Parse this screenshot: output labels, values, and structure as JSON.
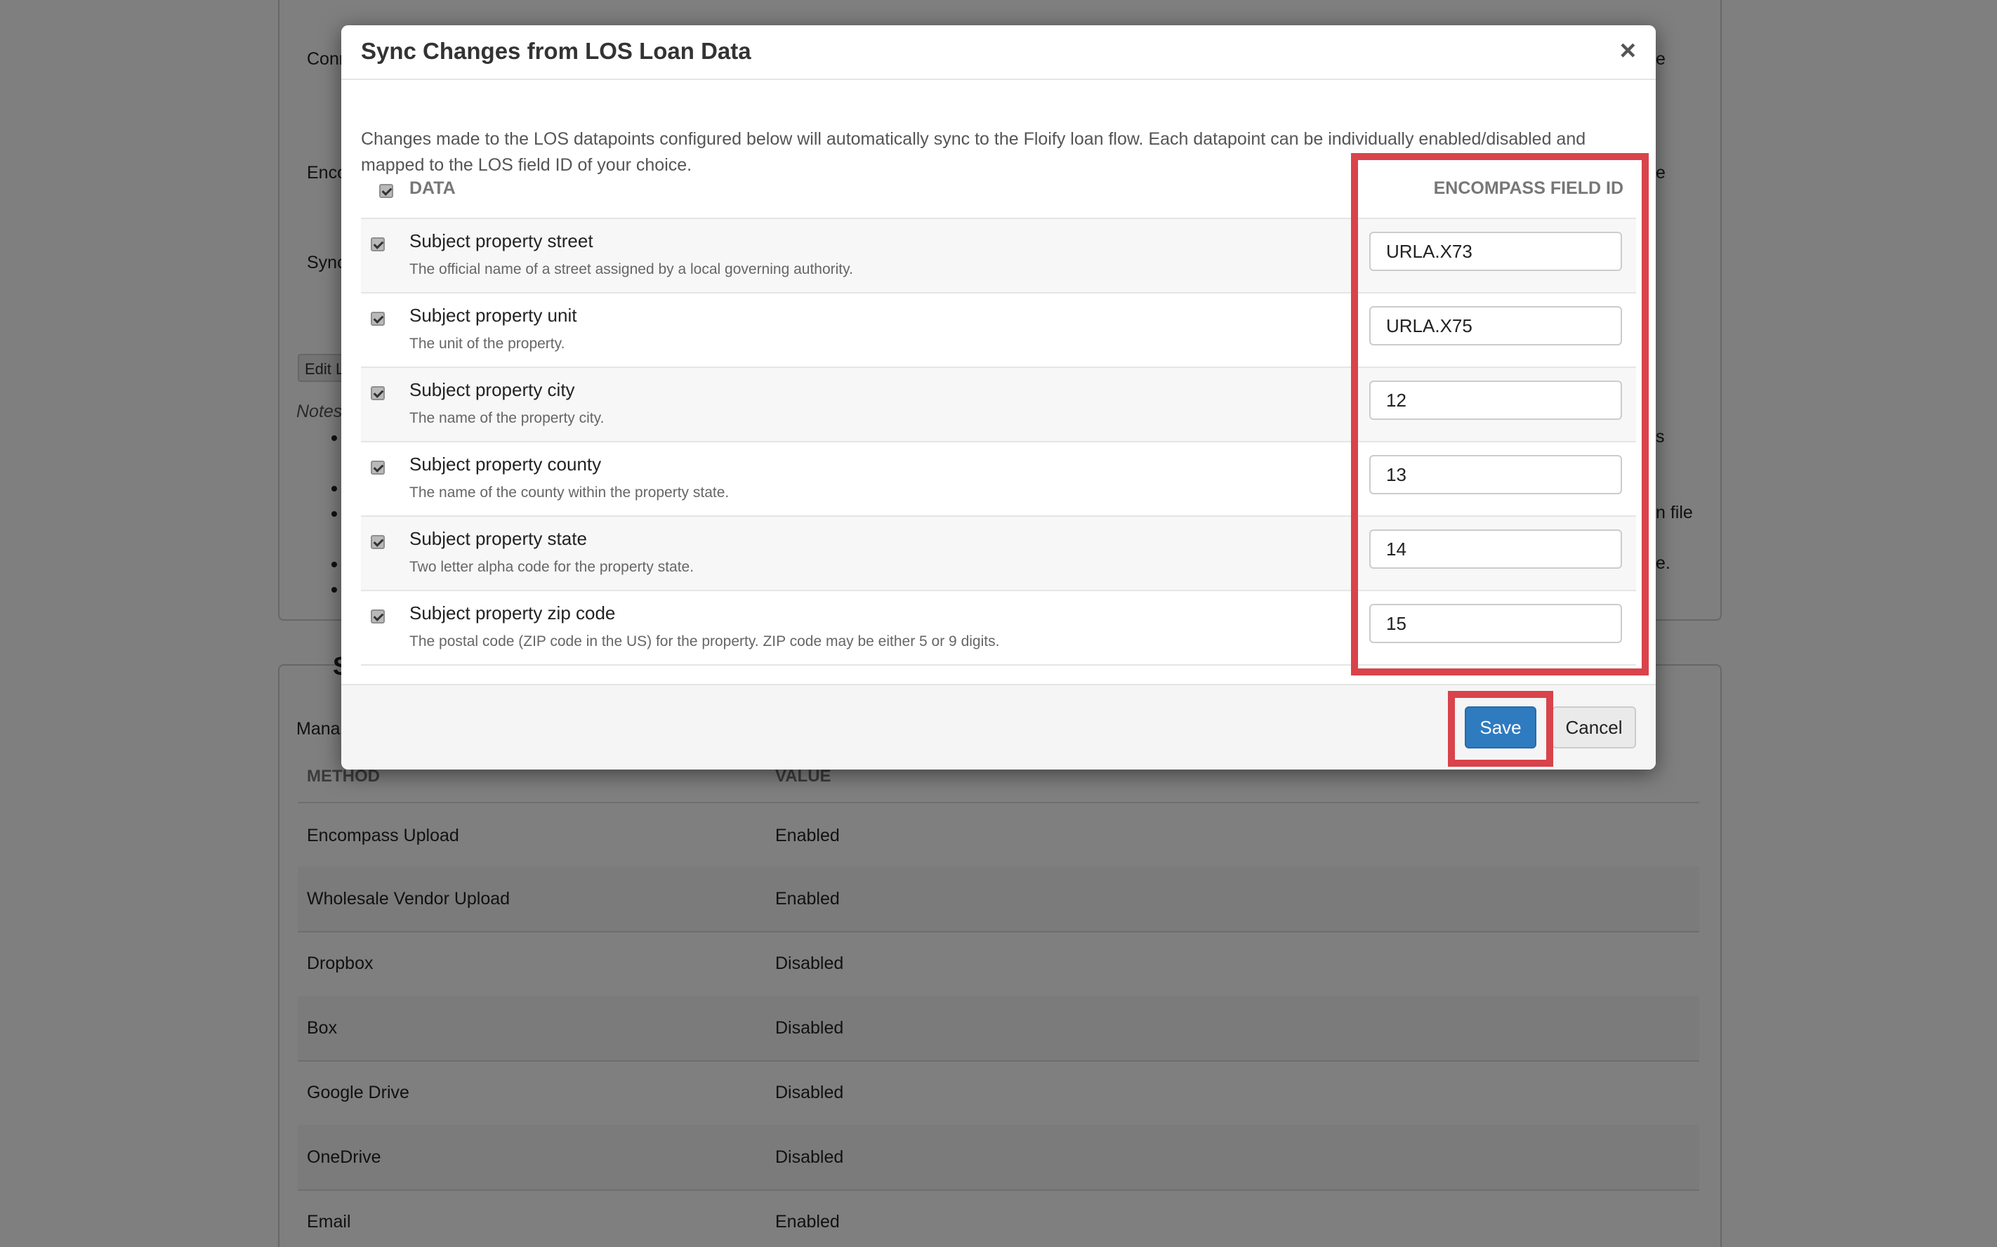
{
  "background": {
    "top_rows": [
      {
        "label": "Conn"
      },
      {
        "label": "Enco"
      },
      {
        "label": "Sync"
      }
    ],
    "edit_button_label": "Edit L",
    "notes_label": "Notes",
    "right_fragments": [
      "e",
      "e",
      "s",
      "n file",
      "e."
    ],
    "section_header_fragment": "S",
    "manage_fragment": "Mana",
    "upload_table": {
      "headers": {
        "method": "METHOD",
        "value": "VALUE"
      },
      "rows": [
        {
          "method": "Encompass Upload",
          "value": "Enabled"
        },
        {
          "method": "Wholesale Vendor Upload",
          "value": "Enabled"
        },
        {
          "method": "Dropbox",
          "value": "Disabled"
        },
        {
          "method": "Box",
          "value": "Disabled"
        },
        {
          "method": "Google Drive",
          "value": "Disabled"
        },
        {
          "method": "OneDrive",
          "value": "Disabled"
        },
        {
          "method": "Email",
          "value": "Enabled"
        }
      ]
    }
  },
  "modal": {
    "title": "Sync Changes from LOS Loan Data",
    "close_label": "×",
    "description": "Changes made to the LOS datapoints configured below will automatically sync to the Floify loan flow. Each datapoint can be individually enabled/disabled and mapped to the LOS field ID of your choice.",
    "table_headers": {
      "data": "DATA",
      "field_id": "ENCOMPASS FIELD ID"
    },
    "rows": [
      {
        "label": "Subject property street",
        "description": "The official name of a street assigned by a local governing authority.",
        "field_id": "URLA.X73",
        "checked": true
      },
      {
        "label": "Subject property unit",
        "description": "The unit of the property.",
        "field_id": "URLA.X75",
        "checked": true
      },
      {
        "label": "Subject property city",
        "description": "The name of the property city.",
        "field_id": "12",
        "checked": true
      },
      {
        "label": "Subject property county",
        "description": "The name of the county within the property state.",
        "field_id": "13",
        "checked": true
      },
      {
        "label": "Subject property state",
        "description": "Two letter alpha code for the property state.",
        "field_id": "14",
        "checked": true
      },
      {
        "label": "Subject property zip code",
        "description": "The postal code (ZIP code in the US) for the property. ZIP code may be either 5 or 9 digits.",
        "field_id": "15",
        "checked": true
      }
    ],
    "save_label": "Save",
    "cancel_label": "Cancel"
  },
  "colors": {
    "highlight": "#d9434b",
    "primary_button": "#2f7bbf",
    "overlay": "rgba(0,0,0,0.5)"
  }
}
